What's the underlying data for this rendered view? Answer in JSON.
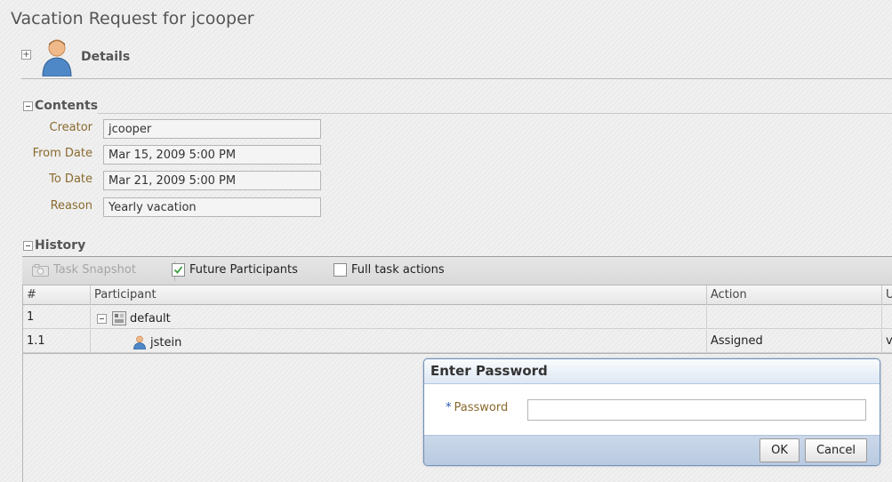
{
  "page": {
    "title": "Vacation Request for jcooper"
  },
  "details": {
    "label": "Details",
    "expand_glyph": "+"
  },
  "contents": {
    "heading": "Contents",
    "fields": [
      {
        "label": "Creator",
        "value": "jcooper"
      },
      {
        "label": "From Date",
        "value": "Mar 15, 2009 5:00 PM"
      },
      {
        "label": "To Date",
        "value": "Mar 21, 2009 5:00 PM"
      },
      {
        "label": "Reason",
        "value": "Yearly vacation"
      }
    ]
  },
  "history": {
    "heading": "History",
    "toolbar": {
      "task_snapshot": "Task Snapshot",
      "future_participants": "Future Participants",
      "future_participants_checked": true,
      "full_task_actions": "Full task actions",
      "full_task_actions_checked": false
    },
    "columns": [
      "#",
      "Participant",
      "Action",
      "U"
    ],
    "rows": [
      {
        "num": "1",
        "participant": "default",
        "action": "",
        "u": ""
      },
      {
        "num": "1.1",
        "participant": "jstein",
        "action": "Assigned",
        "u": "v"
      }
    ]
  },
  "dialog": {
    "title": "Enter Password",
    "required_marker": "*",
    "password_label": "Password",
    "password_value": "",
    "ok_label": "OK",
    "cancel_label": "Cancel"
  },
  "colors": {
    "label_brown": "#8a6a2e",
    "dialog_border": "#6f8fb7",
    "checkmark_green": "#3a9a3a",
    "user_icon_blue": "#4f88c6"
  }
}
